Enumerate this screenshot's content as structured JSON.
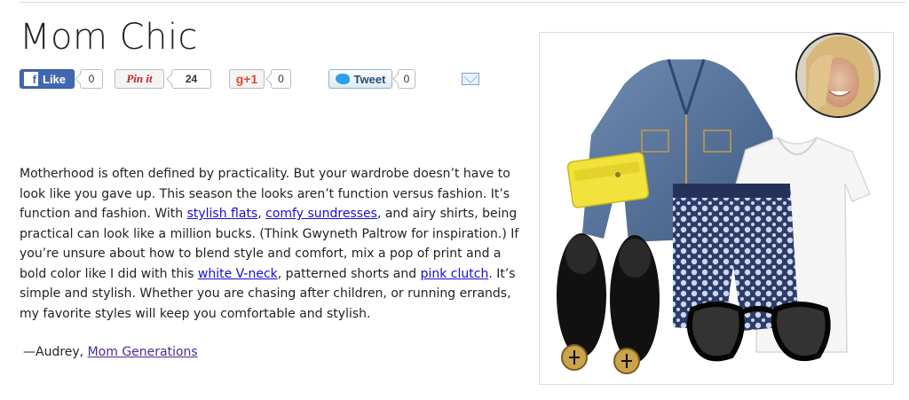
{
  "header": {
    "title": "Mom Chic"
  },
  "share": {
    "facebook": {
      "label": "Like",
      "count": "0"
    },
    "pinterest": {
      "label": "Pin it",
      "count": "24"
    },
    "googleplus": {
      "label": "g+1",
      "count": "0"
    },
    "twitter": {
      "label": "Tweet",
      "count": "0"
    }
  },
  "article": {
    "t1": "Motherhood is often defined by practicality. But your wardrobe doesn’t have to look like you gave up. This season the looks aren’t function versus fashion. It’s function and fashion. With ",
    "link1": "stylish flats",
    "t2": ", ",
    "link2": "comfy sundresses",
    "t3": ", and airy shirts, being practical can look like a million bucks. (Think Gwyneth Paltrow for inspiration.) If you’re unsure about how to blend style and comfort, mix a pop of print and a bold color like I did with this ",
    "link3": "white V-neck",
    "t4": ", patterned shorts and ",
    "link4": "pink clutch",
    "t5": ". It’s simple and stylish. Whether you are chasing after children, or running errands, my favorite styles will keep you comfortable and stylish."
  },
  "signature": {
    "prefix": "—Audrey, ",
    "link": "Mom Generations"
  },
  "colors": {
    "facebook": "#4267b2",
    "pinterest": "#cb2027",
    "googleplus": "#dd4b39",
    "twitter_bird": "#2e9fe6",
    "link": "#1a0dcc",
    "visited_link": "#4b2a8f",
    "clutch": "#f1e33c",
    "denim": "#5b79a0"
  },
  "icons": {
    "facebook": "facebook-f-icon",
    "twitter": "twitter-bird-icon",
    "email": "mail-envelope-icon"
  }
}
